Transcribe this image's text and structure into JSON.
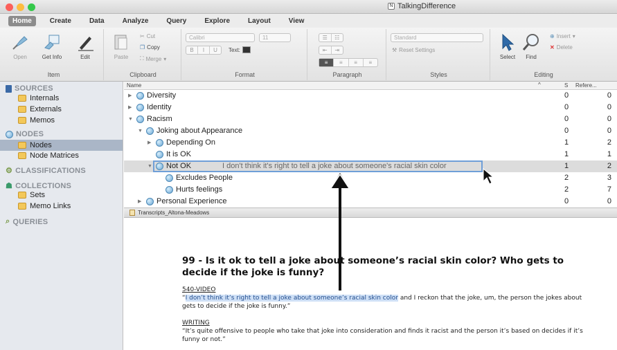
{
  "window": {
    "title": "TalkingDifference"
  },
  "colors": {
    "close": "#fc605b",
    "minimize": "#fdbc40",
    "zoom": "#34c84a",
    "accent": "#6f9fd8"
  },
  "tabs": [
    "Home",
    "Create",
    "Data",
    "Analyze",
    "Query",
    "Explore",
    "Layout",
    "View"
  ],
  "ribbon": {
    "item": {
      "label": "Item",
      "open": "Open",
      "get_info": "Get Info",
      "edit": "Edit"
    },
    "clipboard": {
      "label": "Clipboard",
      "paste": "Paste",
      "cut": "Cut",
      "copy": "Copy",
      "merge": "Merge"
    },
    "format": {
      "label": "Format",
      "font": "Calibri",
      "size": "11",
      "text": "Text:",
      "bold": "B",
      "italic": "I",
      "underline": "U"
    },
    "paragraph": {
      "label": "Paragraph"
    },
    "styles": {
      "label": "Styles",
      "style": "Standard",
      "reset": "Reset Settings"
    },
    "editing": {
      "label": "Editing",
      "select": "Select",
      "find": "Find",
      "insert": "Insert",
      "delete": "Delete"
    }
  },
  "sidebar": {
    "sources": "SOURCES",
    "internals": "Internals",
    "externals": "Externals",
    "memos": "Memos",
    "nodes_section": "NODES",
    "nodes": "Nodes",
    "node_matrices": "Node Matrices",
    "classifications": "CLASSIFICATIONS",
    "collections": "COLLECTIONS",
    "sets": "Sets",
    "memo_links": "Memo Links",
    "queries": "QUERIES"
  },
  "nodelist": {
    "col_name": "Name",
    "col_sources": "S",
    "col_refs": "Refere...",
    "rows": [
      {
        "name": "Diversity",
        "s": "0",
        "r": "0"
      },
      {
        "name": "Identity",
        "s": "0",
        "r": "0"
      },
      {
        "name": "Racism",
        "s": "0",
        "r": "0"
      },
      {
        "name": "Joking about Appearance",
        "s": "0",
        "r": "0"
      },
      {
        "name": "Depending On",
        "s": "1",
        "r": "2"
      },
      {
        "name": "It is OK",
        "s": "1",
        "r": "1"
      },
      {
        "name": "Not OK",
        "s": "1",
        "r": "2",
        "drag_text": "I don't think it's right to tell a joke about someone's racial skin color"
      },
      {
        "name": "Excludes People",
        "s": "2",
        "r": "3"
      },
      {
        "name": "Hurts feelings",
        "s": "2",
        "r": "7"
      },
      {
        "name": "Personal Experience",
        "s": "0",
        "r": "0"
      }
    ]
  },
  "doc_tab": "Transcripts_Altona-Meadows",
  "document": {
    "heading": "99 - Is it ok to tell a joke about someone’s racial skin color? Who gets to decide if the joke is funny?",
    "video_label": "540-VIDEO",
    "video_open_quote": "“",
    "video_highlight": "I don’t think it’s right to tell a joke about someone’s racial skin color",
    "video_rest": " and I reckon that the joke, um, the person the jokes about gets to decide if the joke is funny.”",
    "writing_label": "WRITING",
    "writing_text": "“It’s quite offensive to people who take that joke into consideration and finds it racist and the person it’s based on decides if it’s funny or not.”"
  }
}
